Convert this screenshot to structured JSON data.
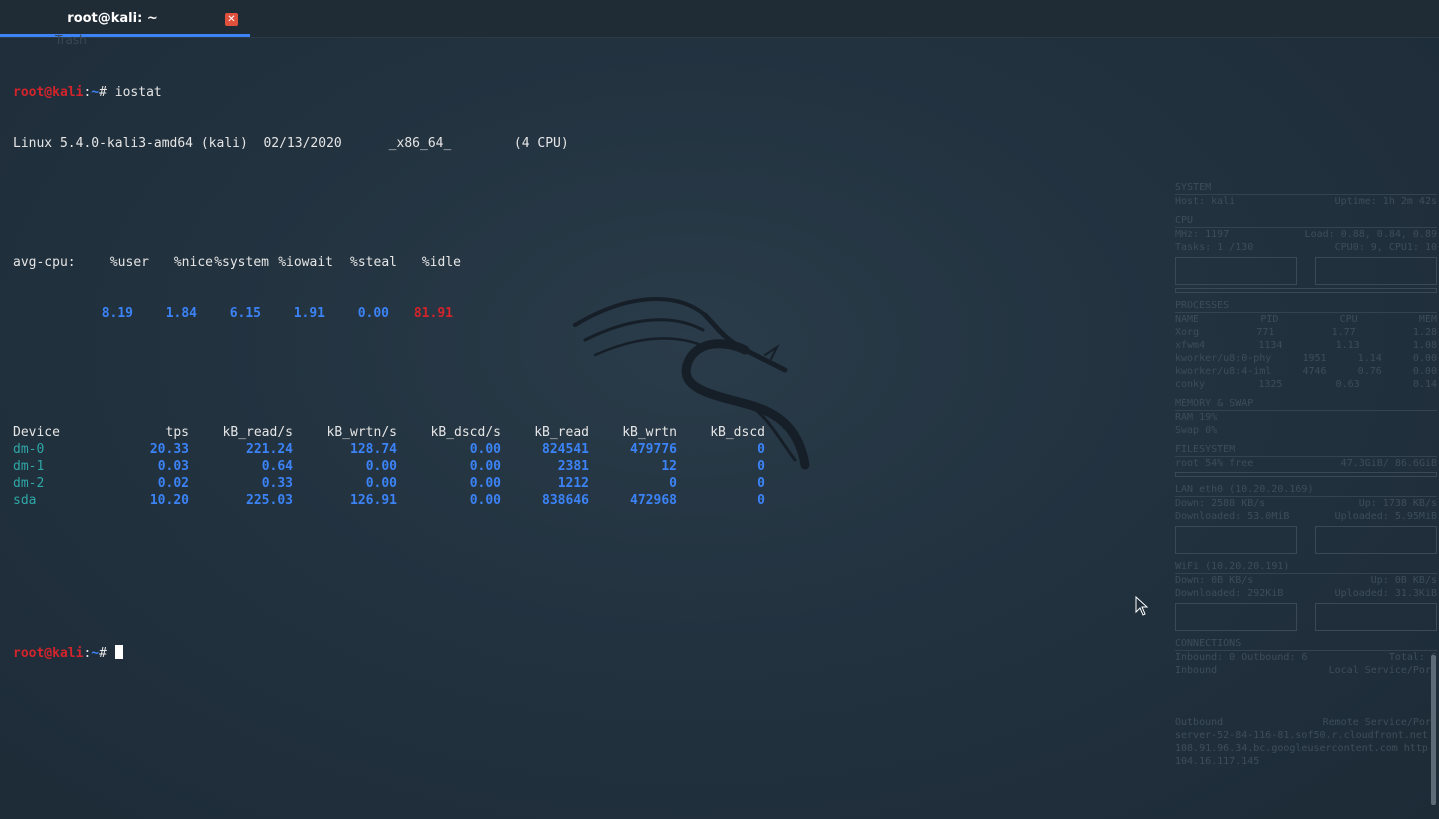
{
  "window": {
    "tab_title": "root@kali: ~",
    "close_glyph": "✕",
    "desktop_ghost_label": "Trash"
  },
  "terminal": {
    "prompt_user": "root@kali",
    "prompt_sep": ":",
    "prompt_path": "~",
    "prompt_hash": "# ",
    "command": "iostat",
    "sysinfo": "Linux 5.4.0-kali3-amd64 (kali)  02/13/2020      _x86_64_        (4 CPU)",
    "cpu_header": {
      "label": "avg-cpu:",
      "user": "%user",
      "nice": "%nice",
      "system": "%system",
      "iowait": "%iowait",
      "steal": "%steal",
      "idle": "%idle"
    },
    "cpu_values": {
      "user": "8.19",
      "nice": "1.84",
      "system": "6.15",
      "iowait": "1.91",
      "steal": "0.00",
      "idle": "81.91"
    },
    "device_headers": [
      "Device",
      "tps",
      "kB_read/s",
      "kB_wrtn/s",
      "kB_dscd/s",
      "kB_read",
      "kB_wrtn",
      "kB_dscd"
    ],
    "devices": [
      {
        "name": "dm-0",
        "tps": "20.33",
        "read_s": "221.24",
        "wrtn_s": "128.74",
        "dscd_s": "0.00",
        "read": "824541",
        "wrtn": "479776",
        "dscd": "0"
      },
      {
        "name": "dm-1",
        "tps": "0.03",
        "read_s": "0.64",
        "wrtn_s": "0.00",
        "dscd_s": "0.00",
        "read": "2381",
        "wrtn": "12",
        "dscd": "0"
      },
      {
        "name": "dm-2",
        "tps": "0.02",
        "read_s": "0.33",
        "wrtn_s": "0.00",
        "dscd_s": "0.00",
        "read": "1212",
        "wrtn": "0",
        "dscd": "0"
      },
      {
        "name": "sda",
        "tps": "10.20",
        "read_s": "225.03",
        "wrtn_s": "126.91",
        "dscd_s": "0.00",
        "read": "838646",
        "wrtn": "472968",
        "dscd": "0"
      }
    ]
  },
  "conky": {
    "system_hdr": "SYSTEM",
    "host": "Host: kali",
    "uptime": "Uptime: 1h 2m 42s",
    "cpu_hdr": "CPU",
    "mhz": "MHz: 1197",
    "load": "Load: 0.88, 0.84, 0.89",
    "tasks": "Tasks: 1 /130",
    "cpus": "CPU0: 9, CPU1: 10",
    "proc_hdr": "PROCESSES",
    "proc_cols": [
      "NAME",
      "PID",
      "CPU",
      "MEM"
    ],
    "procs": [
      [
        "Xorg",
        "771",
        "1.77",
        "1.28"
      ],
      [
        "xfwm4",
        "1134",
        "1.13",
        "1.08"
      ],
      [
        "kworker/u8:0-phy",
        "1951",
        "1.14",
        "0.00"
      ],
      [
        "kworker/u8:4-iml",
        "4746",
        "0.76",
        "0.00"
      ],
      [
        "conky",
        "1325",
        "0.63",
        "0.14"
      ]
    ],
    "mem_hdr": "MEMORY & SWAP",
    "ram": "RAM  19%",
    "swap": "Swap  0%",
    "fs_hdr": "FILESYSTEM",
    "root": "root 54% free",
    "root_size": "47.3GiB/ 86.6GiB",
    "lan_hdr": "LAN eth0 (10.20.20.169)",
    "lan_down": "Down: 2588    KB/s",
    "lan_up": "Up: 1738    KB/s",
    "lan_dl": "Downloaded: 53.0MiB",
    "lan_ul": "Uploaded: 5.95MiB",
    "wifi_hdr": "WiFi (10.20.20.191)",
    "wifi_down": "Down: 0B    KB/s",
    "wifi_up": "Up: 0B    KB/s",
    "wifi_dl": "Downloaded: 292KiB",
    "wifi_ul": "Uploaded: 31.3KiB",
    "conn_hdr": "CONNECTIONS",
    "inbound": "Inbound: 0  Outbound: 6",
    "total": "Total: 6",
    "inbound2": "Inbound",
    "local_svc": "Local Service/Port",
    "outbound": "Outbound",
    "remote_svc": "Remote Service/Port",
    "out1": "server-52-84-116-81.sof50.r.cloudfront.net",
    "out2": "108.91.96.34.bc.googleusercontent.com http",
    "out3": "104.16.117.145"
  }
}
